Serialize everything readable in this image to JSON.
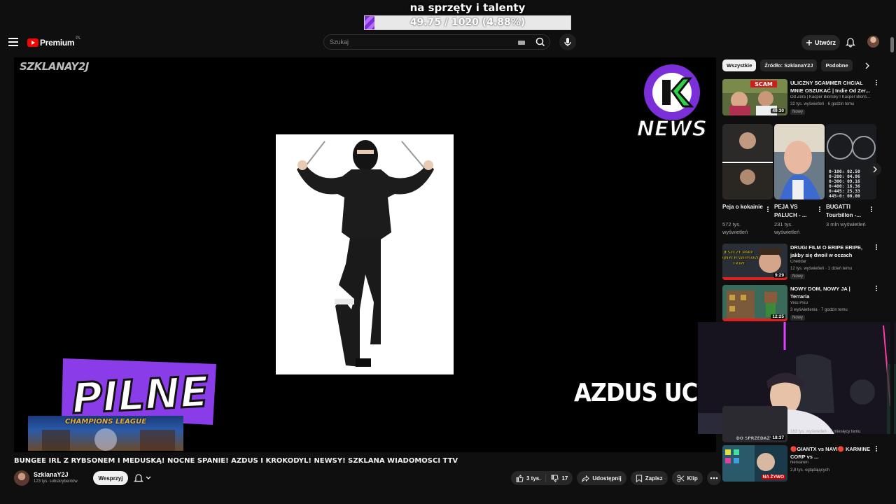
{
  "overlay": {
    "goal_title": "na sprzęty i talenty",
    "goal_text": "49.75 / 1020 (4.88%)",
    "goal_fraction": 0.0488
  },
  "header": {
    "logo_text": "Premium",
    "country_code": "PL",
    "search_placeholder": "Szukaj",
    "create_label": "Utwórz"
  },
  "player": {
    "watermark": "SZKLANAY2J",
    "news_logo_text": "NEWS",
    "pilne_text": "PILNE",
    "ticker_text": "AZDUS UCIEK",
    "banner_text": "CHAMPIONS LEAGUE"
  },
  "video": {
    "title": "BUNGEE IRL Z RYBSONEM I MEDUSKĄ! NOCNE SPANIE! AZDUS I KROKODYL! NEWSY! SZKLANA WIADOMOŚCI TTV",
    "channel_name": "SzklanaY2J",
    "subscribers": "123 tys. subskrybentów",
    "support_label": "Wesprzyj",
    "likes": "3 tys.",
    "dislikes": "17",
    "share_label": "Udostępnij",
    "save_label": "Zapisz",
    "clip_label": "Klip"
  },
  "sidebar": {
    "chips": [
      "Wszystkie",
      "Źródło: SzklanaY2J",
      "Podobne"
    ],
    "recommendations": [
      {
        "title": "ULICZNY SCAMMER CHCIAŁ MNIE OSZUKAĆ | Indie Od Zer...",
        "channel": "Od Zera | Kacper Błonsky I Kacper Błons...",
        "meta": "32 tys. wyświetleń · 6 godzin temu",
        "badge": "Nowy",
        "duration": "49:30",
        "thumb_text": "SCAM"
      },
      {
        "title": "DRUGI FILM O ERIPE ERIPE, jakby się dwoił w oczach",
        "channel": "Cheddar",
        "meta": "12 tys. wyświetleń · 1 dzień temu",
        "badge": "Nowy",
        "duration": "9:29",
        "thumb_text": "JESZCZE PARĘ FAJNYCH WERSÓW ERIPE"
      },
      {
        "title": "NOWY DOM, NOWY JA | Terraria",
        "channel": "Vixu Pixu",
        "meta": "3 wyświetlenia · 7 godzin temu",
        "badge": "Nowy",
        "duration": "12:25",
        "thumb_text": ""
      },
      {
        "title": "",
        "channel": "",
        "meta": "183 tys. wyświetleń · 7 miesięcy temu",
        "badge": "",
        "duration": "18:37",
        "thumb_text": "DO SPRZEDAŻY"
      },
      {
        "title": "🔴GIANTX vs NAVI🔴 KARMINE CORP vs ...",
        "channel": "Nervarien",
        "meta": "2,8 tys. oglądających",
        "badge": "",
        "duration": "NA ŻYWO",
        "thumb_text": ""
      }
    ],
    "shorts": [
      {
        "title": "Peja o kokainie",
        "views": "572 tys. wyświetleń"
      },
      {
        "title": "PEJA VS PALUCH - ...",
        "views": "231 tys. wyświetleń"
      },
      {
        "title": "BUGATTI Tourbillon -...",
        "views": "3 mln wyświetleń"
      }
    ],
    "bugatti_readout": "0-100: 02.50\n0-200: 04.86\n0-300: 09.16\n0-400: 16.36\n0-445: 25.33\n445-0: 00.00"
  },
  "colors": {
    "background": "#0f0f0f",
    "accent_red": "#ff0000",
    "pilne_purple": "#7a2fd9",
    "news_green": "#2cd24a"
  }
}
